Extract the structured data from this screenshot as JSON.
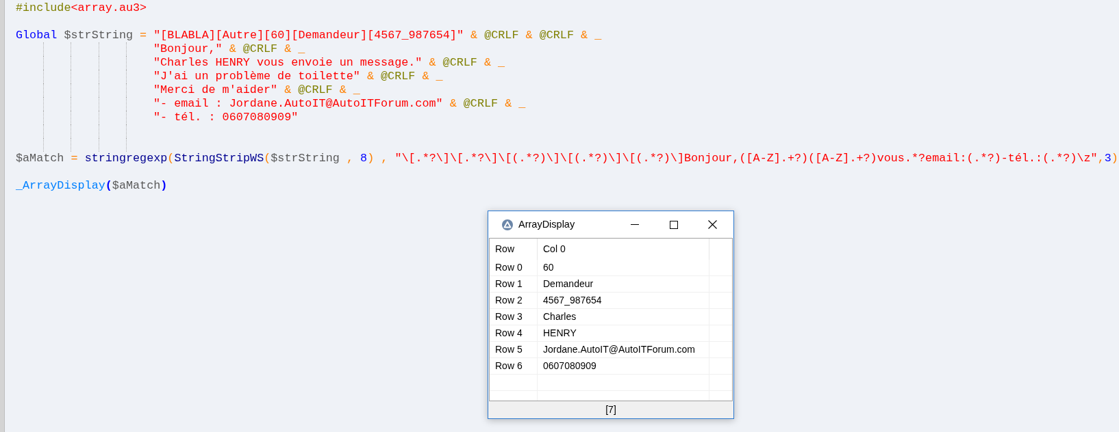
{
  "editor": {
    "lines": [
      {
        "kind": "code",
        "tokens": [
          {
            "kind": "directive",
            "t": "#include"
          },
          {
            "kind": "include_file",
            "t": "<array.au3>"
          }
        ]
      },
      {
        "kind": "blank"
      },
      {
        "kind": "code",
        "tokens": [
          {
            "kind": "keyword",
            "t": "Global "
          },
          {
            "kind": "variable",
            "t": "$strString"
          },
          {
            "kind": "operator",
            "t": " = "
          },
          {
            "kind": "string",
            "t": "\"[BLABLA][Autre][60][Demandeur][4567_987654]\""
          },
          {
            "kind": "operator",
            "t": " & "
          },
          {
            "kind": "macro",
            "t": "@CRLF"
          },
          {
            "kind": "operator",
            "t": " & "
          },
          {
            "kind": "macro",
            "t": "@CRLF"
          },
          {
            "kind": "operator",
            "t": " & _"
          }
        ]
      },
      {
        "kind": "continuation",
        "indent_guides": true,
        "tokens": [
          {
            "kind": "string",
            "t": "\"Bonjour,\""
          },
          {
            "kind": "operator",
            "t": " & "
          },
          {
            "kind": "macro",
            "t": "@CRLF"
          },
          {
            "kind": "operator",
            "t": " & _"
          }
        ]
      },
      {
        "kind": "continuation",
        "indent_guides": true,
        "tokens": [
          {
            "kind": "string",
            "t": "\"Charles HENRY vous envoie un message.\""
          },
          {
            "kind": "operator",
            "t": " & "
          },
          {
            "kind": "macro",
            "t": "@CRLF"
          },
          {
            "kind": "operator",
            "t": " & _"
          }
        ]
      },
      {
        "kind": "continuation",
        "indent_guides": true,
        "tokens": [
          {
            "kind": "string",
            "t": "\"J'ai un problème de toilette\""
          },
          {
            "kind": "operator",
            "t": " & "
          },
          {
            "kind": "macro",
            "t": "@CRLF"
          },
          {
            "kind": "operator",
            "t": " & _"
          }
        ]
      },
      {
        "kind": "continuation",
        "indent_guides": true,
        "tokens": [
          {
            "kind": "string",
            "t": "\"Merci de m'aider\""
          },
          {
            "kind": "operator",
            "t": " & "
          },
          {
            "kind": "macro",
            "t": "@CRLF"
          },
          {
            "kind": "operator",
            "t": " & _"
          }
        ]
      },
      {
        "kind": "continuation",
        "indent_guides": true,
        "tokens": [
          {
            "kind": "string",
            "t": "\"- email : Jordane.AutoIT@AutoITForum.com\""
          },
          {
            "kind": "operator",
            "t": " & "
          },
          {
            "kind": "macro",
            "t": "@CRLF"
          },
          {
            "kind": "operator",
            "t": " & _"
          }
        ]
      },
      {
        "kind": "continuation",
        "indent_guides": true,
        "tokens": [
          {
            "kind": "string",
            "t": "\"- tél. : 0607080909\""
          }
        ]
      },
      {
        "kind": "blank",
        "indent_guides": true
      },
      {
        "kind": "blank",
        "indent_guides": true
      },
      {
        "kind": "code",
        "tokens": [
          {
            "kind": "variable",
            "t": "$aMatch"
          },
          {
            "kind": "operator",
            "t": " = "
          },
          {
            "kind": "builtin",
            "t": "stringregexp"
          },
          {
            "kind": "operator",
            "t": "("
          },
          {
            "kind": "builtin",
            "t": "StringStripWS"
          },
          {
            "kind": "operator",
            "t": "("
          },
          {
            "kind": "variable",
            "t": "$strString"
          },
          {
            "kind": "operator",
            "t": " , "
          },
          {
            "kind": "number",
            "t": "8"
          },
          {
            "kind": "operator",
            "t": ")"
          },
          {
            "kind": "operator",
            "t": " , "
          },
          {
            "kind": "string",
            "t": "\"\\[.*?\\]\\[.*?\\]\\[(.*?)\\]\\[(.*?)\\]\\[(.*?)\\]Bonjour,([A-Z].+?)([A-Z].+?)vous.*?email:(.*?)-tél.:(.*?)\\z\""
          },
          {
            "kind": "operator",
            "t": ","
          },
          {
            "kind": "number",
            "t": "3"
          },
          {
            "kind": "operator",
            "t": ")"
          }
        ]
      },
      {
        "kind": "blank"
      },
      {
        "kind": "code",
        "tokens": [
          {
            "kind": "udf",
            "t": "_ArrayDisplay"
          },
          {
            "kind": "bracket",
            "t": "("
          },
          {
            "kind": "variable",
            "t": "$aMatch"
          },
          {
            "kind": "bracket",
            "t": ")"
          }
        ]
      }
    ]
  },
  "dialog": {
    "title": "ArrayDisplay",
    "table": {
      "columns": [
        "Row",
        "Col 0"
      ],
      "rows": [
        {
          "label": "Row 0",
          "value": "60"
        },
        {
          "label": "Row 1",
          "value": "Demandeur"
        },
        {
          "label": "Row 2",
          "value": "4567_987654"
        },
        {
          "label": "Row 3",
          "value": "Charles"
        },
        {
          "label": "Row 4",
          "value": "HENRY"
        },
        {
          "label": "Row 5",
          "value": "Jordane.AutoIT@AutoITForum.com"
        },
        {
          "label": "Row 6",
          "value": "0607080909"
        }
      ]
    },
    "status_bar": "[7]"
  }
}
